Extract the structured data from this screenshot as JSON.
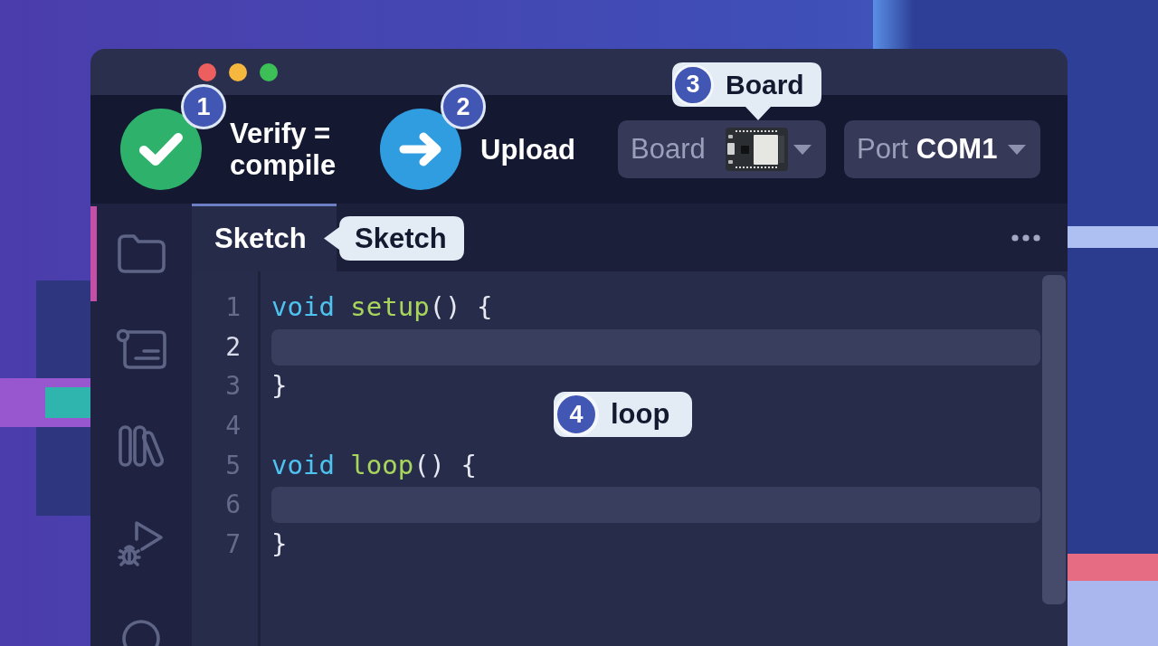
{
  "toolbar": {
    "verify": {
      "label": "Verify = compile",
      "badge": "1"
    },
    "upload": {
      "label": "Upload",
      "badge": "2"
    },
    "board": {
      "label": "Board",
      "callout": {
        "badge": "3",
        "label": "Board"
      }
    },
    "port": {
      "label": "Port",
      "value": "COM1"
    }
  },
  "sidebar": {
    "items": [
      {
        "selected": true
      },
      {
        "selected": false
      },
      {
        "selected": false
      },
      {
        "selected": false
      },
      {
        "selected": false
      }
    ]
  },
  "tabs": [
    {
      "label": "Sketch",
      "selected": true
    }
  ],
  "tab_callout": {
    "label": "Sketch"
  },
  "editor": {
    "lines": [
      {
        "number": "1",
        "current": false,
        "highlighted": false,
        "tokens": [
          {
            "kind": "keyword",
            "text": "void"
          },
          {
            "kind": "function",
            "text": " setup"
          },
          {
            "kind": "punct",
            "text": "() {"
          }
        ]
      },
      {
        "number": "2",
        "current": true,
        "highlighted": true
      },
      {
        "number": "3",
        "current": false,
        "highlighted": false,
        "tokens": [
          {
            "kind": "punct",
            "text": "}"
          }
        ]
      },
      {
        "number": "4",
        "current": false,
        "highlighted": false
      },
      {
        "number": "5",
        "current": false,
        "highlighted": false,
        "tokens": [
          {
            "kind": "keyword",
            "text": "void"
          },
          {
            "kind": "function",
            "text": " loop"
          },
          {
            "kind": "punct",
            "text": "() {"
          }
        ]
      },
      {
        "number": "6",
        "current": false,
        "highlighted": true
      },
      {
        "number": "7",
        "current": false,
        "highlighted": false,
        "tokens": [
          {
            "kind": "punct",
            "text": "}"
          }
        ]
      }
    ],
    "callout": {
      "badge": "4",
      "label": "loop"
    }
  }
}
